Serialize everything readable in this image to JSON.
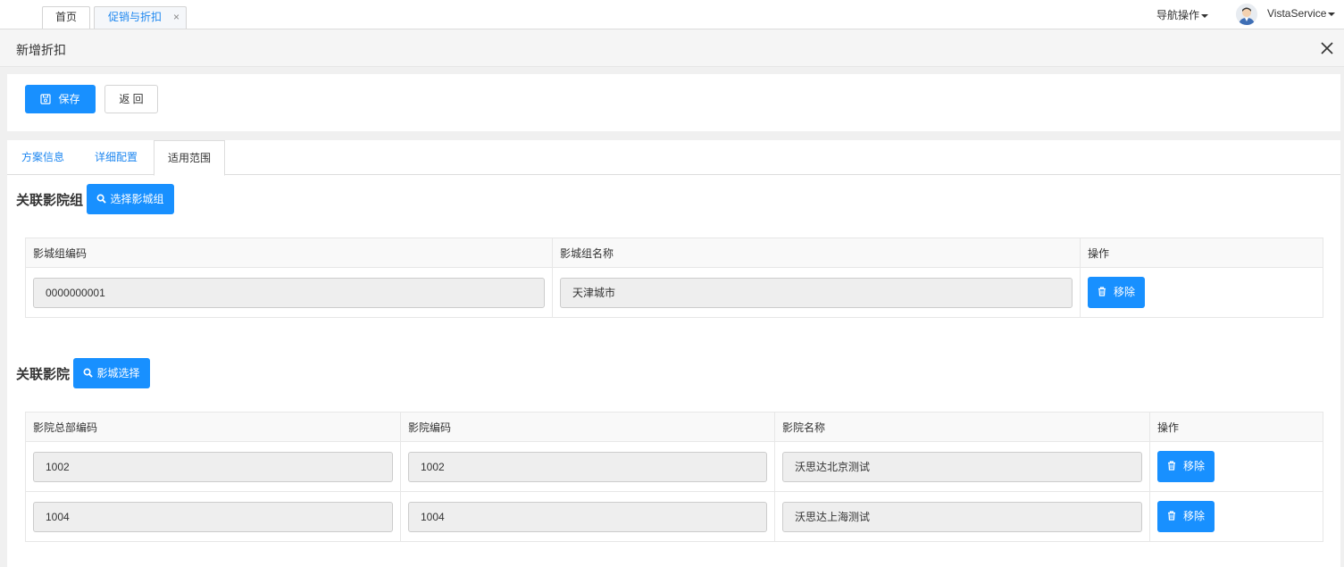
{
  "topbar": {
    "tabs": [
      {
        "label": "首页"
      },
      {
        "label": "促销与折扣",
        "close": "×"
      }
    ],
    "nav_menu": "导航操作",
    "user_name": "VistaService"
  },
  "header": {
    "title": "新增折扣"
  },
  "toolbar": {
    "save_label": "保存",
    "back_label": "返 回"
  },
  "tabs": [
    {
      "label": "方案信息"
    },
    {
      "label": "详细配置"
    },
    {
      "label": "适用范围"
    }
  ],
  "cinema_group": {
    "title": "关联影院组",
    "select_button": "选择影城组",
    "columns": [
      "影城组编码",
      "影城组名称",
      "操作"
    ],
    "rows": [
      {
        "code": "0000000001",
        "name": "天津城市",
        "action": "移除"
      }
    ]
  },
  "cinema": {
    "title": "关联影院",
    "select_button": "影城选择",
    "columns": [
      "影院总部编码",
      "影院编码",
      "影院名称",
      "操作"
    ],
    "rows": [
      {
        "hq_code": "1002",
        "code": "1002",
        "name": "沃思达北京测试",
        "action": "移除"
      },
      {
        "hq_code": "1004",
        "code": "1004",
        "name": "沃思达上海测试",
        "action": "移除"
      }
    ]
  },
  "colors": {
    "primary": "#1890ff",
    "link": "#1e87f0"
  }
}
